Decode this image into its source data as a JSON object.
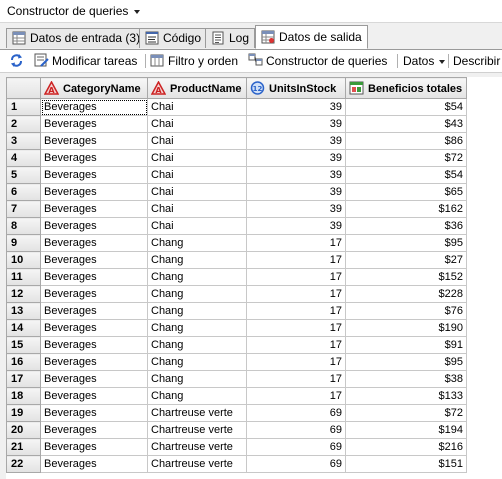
{
  "title_menu": {
    "label": "Constructor de queries"
  },
  "tabs": [
    {
      "label": "Datos de entrada (3)",
      "icon": "data-table-icon",
      "active": false
    },
    {
      "label": "Código",
      "icon": "code-icon",
      "active": false
    },
    {
      "label": "Log",
      "icon": "log-icon",
      "active": false
    },
    {
      "label": "Datos de salida",
      "icon": "output-table-icon",
      "active": true
    }
  ],
  "toolbar": {
    "refresh_icon": "refresh-icon",
    "modify_tasks": "Modificar tareas",
    "filter_sort": "Filtro y orden",
    "query_builder": "Constructor de queries",
    "data_menu": "Datos",
    "describe_menu": "Describir"
  },
  "grid": {
    "columns": [
      {
        "label": "CategoryName",
        "type_icon": "character-column-icon"
      },
      {
        "label": "ProductName",
        "type_icon": "character-column-icon"
      },
      {
        "label": "UnitsInStock",
        "type_icon": "numeric-column-icon"
      },
      {
        "label": "Beneficios totales",
        "type_icon": "computed-column-icon"
      }
    ],
    "rows": [
      {
        "n": "1",
        "category": "Beverages",
        "product": "Chai",
        "units": "39",
        "profit": "$54"
      },
      {
        "n": "2",
        "category": "Beverages",
        "product": "Chai",
        "units": "39",
        "profit": "$43"
      },
      {
        "n": "3",
        "category": "Beverages",
        "product": "Chai",
        "units": "39",
        "profit": "$86"
      },
      {
        "n": "4",
        "category": "Beverages",
        "product": "Chai",
        "units": "39",
        "profit": "$72"
      },
      {
        "n": "5",
        "category": "Beverages",
        "product": "Chai",
        "units": "39",
        "profit": "$54"
      },
      {
        "n": "6",
        "category": "Beverages",
        "product": "Chai",
        "units": "39",
        "profit": "$65"
      },
      {
        "n": "7",
        "category": "Beverages",
        "product": "Chai",
        "units": "39",
        "profit": "$162"
      },
      {
        "n": "8",
        "category": "Beverages",
        "product": "Chai",
        "units": "39",
        "profit": "$36"
      },
      {
        "n": "9",
        "category": "Beverages",
        "product": "Chang",
        "units": "17",
        "profit": "$95"
      },
      {
        "n": "10",
        "category": "Beverages",
        "product": "Chang",
        "units": "17",
        "profit": "$27"
      },
      {
        "n": "11",
        "category": "Beverages",
        "product": "Chang",
        "units": "17",
        "profit": "$152"
      },
      {
        "n": "12",
        "category": "Beverages",
        "product": "Chang",
        "units": "17",
        "profit": "$228"
      },
      {
        "n": "13",
        "category": "Beverages",
        "product": "Chang",
        "units": "17",
        "profit": "$76"
      },
      {
        "n": "14",
        "category": "Beverages",
        "product": "Chang",
        "units": "17",
        "profit": "$190"
      },
      {
        "n": "15",
        "category": "Beverages",
        "product": "Chang",
        "units": "17",
        "profit": "$91"
      },
      {
        "n": "16",
        "category": "Beverages",
        "product": "Chang",
        "units": "17",
        "profit": "$95"
      },
      {
        "n": "17",
        "category": "Beverages",
        "product": "Chang",
        "units": "17",
        "profit": "$38"
      },
      {
        "n": "18",
        "category": "Beverages",
        "product": "Chang",
        "units": "17",
        "profit": "$133"
      },
      {
        "n": "19",
        "category": "Beverages",
        "product": "Chartreuse verte",
        "units": "69",
        "profit": "$72"
      },
      {
        "n": "20",
        "category": "Beverages",
        "product": "Chartreuse verte",
        "units": "69",
        "profit": "$194"
      },
      {
        "n": "21",
        "category": "Beverages",
        "product": "Chartreuse verte",
        "units": "69",
        "profit": "$216"
      },
      {
        "n": "22",
        "category": "Beverages",
        "product": "Chartreuse verte",
        "units": "69",
        "profit": "$151"
      }
    ]
  },
  "colors": {
    "character_icon": "#cc2222",
    "numeric_icon": "#2a62c9",
    "computed_icon": "#3a9a3a"
  }
}
